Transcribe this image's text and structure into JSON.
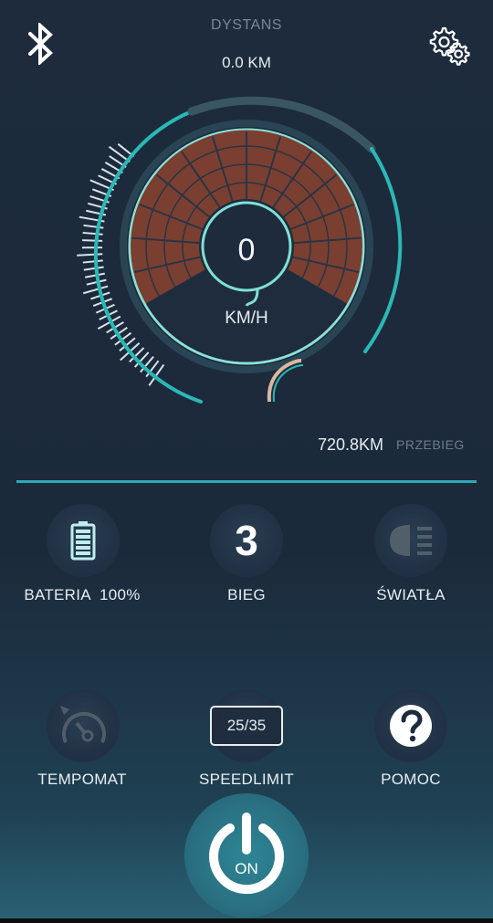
{
  "header": {
    "distance_label": "DYSTANS",
    "distance_value": "0.0 KM"
  },
  "icons": {
    "bluetooth": "bluetooth-icon",
    "settings": "gear-icon"
  },
  "speedometer": {
    "speed": "0",
    "unit": "KM/H"
  },
  "odometer": {
    "value": "720.8KM",
    "label": "PRZEBIEG"
  },
  "status": {
    "battery_label": "BATERIA  100%",
    "gear_value": "3",
    "gear_label": "BIEG",
    "lights_label": "ŚWIATŁA"
  },
  "controls": {
    "cruise_label": "TEMPOMAT",
    "speedlimit_value": "25/35",
    "speedlimit_label": "SPEEDLIMIT",
    "help_label": "POMOC"
  },
  "power": {
    "state": "ON"
  },
  "colors": {
    "accent": "#2fc4c4",
    "background": "#1d2b3d",
    "gauge_fill": "#7a3f30"
  }
}
